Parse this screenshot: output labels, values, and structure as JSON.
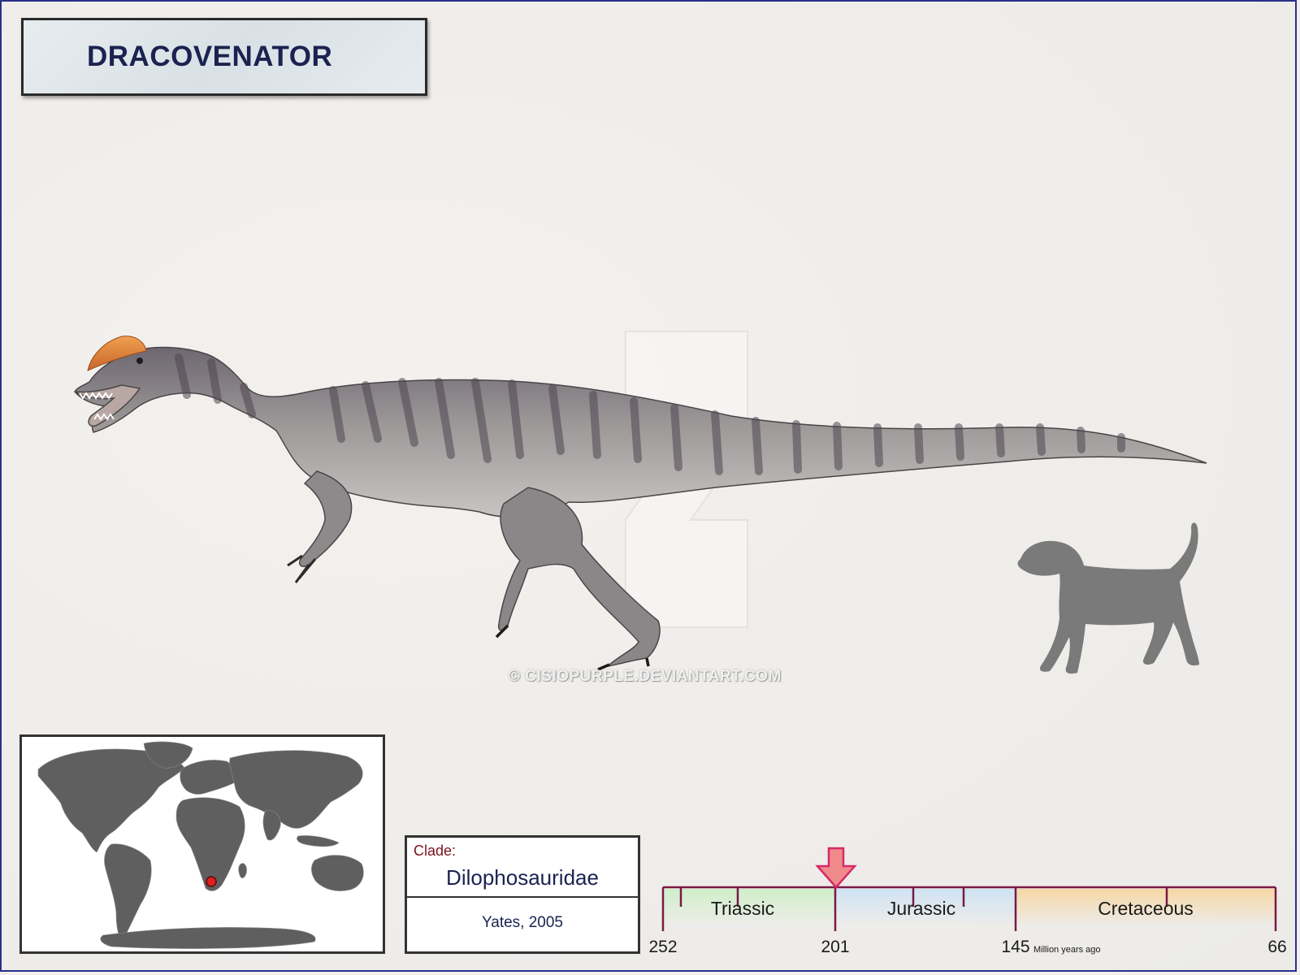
{
  "title": "DRACOVENATOR",
  "watermark": "© CISIOPURPLE.DEVIANTART.COM",
  "clade": {
    "label": "Clade:",
    "name": "Dilophosauridae",
    "author": "Yates, 2005"
  },
  "timeline": {
    "periods": [
      {
        "name": "Triassic",
        "color": "#cfeec9"
      },
      {
        "name": "Jurassic",
        "color": "#cfe3f3"
      },
      {
        "name": "Cretaceous",
        "color": "#f6d7a6"
      }
    ],
    "ticks": [
      "252",
      "201",
      "145",
      "66"
    ],
    "unit": "Million years ago",
    "marker_value": "201",
    "marker_color": "#f08a8a",
    "line_color": "#7a1a45"
  },
  "map": {
    "location_color": "#e0201c",
    "land_color": "#5f5f5f"
  },
  "colors": {
    "border": "#2b2f8a",
    "title_text": "#1a2350"
  }
}
